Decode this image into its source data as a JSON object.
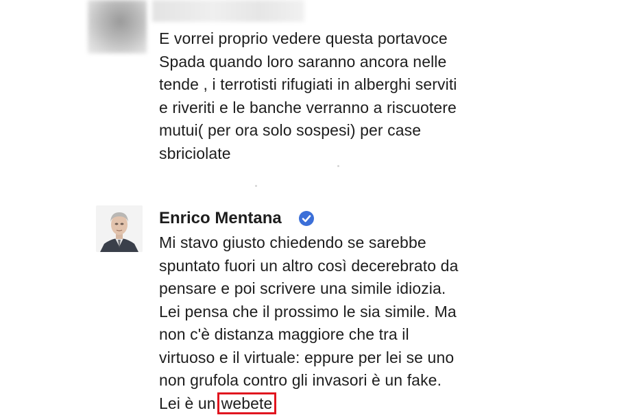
{
  "comments": [
    {
      "text": "E vorrei proprio vedere questa portavoce\nSpada quando loro saranno ancora nelle\ntende , i terrotisti rifugiati in alberghi serviti\ne riveriti e le banche verranno a riscuotere\nmutui( per ora solo sospesi) per case\nsbriciolate"
    },
    {
      "author": "Enrico Mentana",
      "text_before": "Mi stavo giusto chiedendo se sarebbe\nspuntato fuori un altro così decerebrato da\npensare e poi scrivere una simile idiozia.\nLei pensa che il prossimo le sia simile. Ma\nnon c'è distanza maggiore che tra il\nvirtuoso e il virtuale: eppure per lei se uno\nnon grufola contro gli invasori è un fake.\nLei è un",
      "highlight": "webete",
      "verified_icon": "verified-badge-icon"
    }
  ],
  "colors": {
    "highlight_border": "#e0141e",
    "verified_blue": "#3b6fd8",
    "text": "#1d1d1d"
  }
}
